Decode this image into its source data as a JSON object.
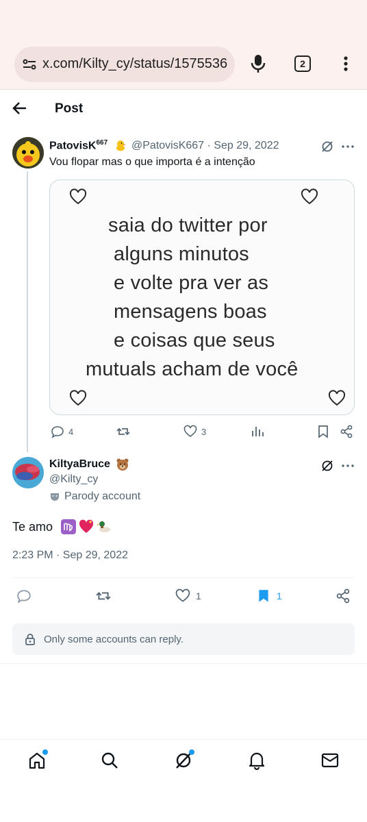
{
  "browser": {
    "url": "x.com/Kilty_cy/status/1575536",
    "tab_count": "2",
    "icons": [
      "site-settings-icon",
      "microphone-icon",
      "tabs-icon",
      "more-vert-icon"
    ]
  },
  "header": {
    "title": "Post"
  },
  "quoted_tweet": {
    "display_name": "PatovisK",
    "display_name_sup": "667",
    "handle_meta": "@PatovisK667 · Sep 29, 2022",
    "text": "Vou flopar mas o que importa é a intenção",
    "media_lines": [
      "saia do twitter por",
      "alguns minutos",
      "e volte pra ver as",
      "mensagens boas",
      "e coisas que seus",
      "mutuals acham de você"
    ],
    "actions": {
      "replies": "4",
      "retweets": "",
      "likes": "3",
      "views": ""
    }
  },
  "main_tweet": {
    "display_name": "KiltyaBruce",
    "handle": "@Kilty_cy",
    "parody_label": "Parody account",
    "text": "Te amo",
    "timestamp": "2:23 PM · Sep 29, 2022",
    "actions": {
      "replies": "",
      "retweets": "",
      "likes": "1",
      "bookmarks": "1"
    }
  },
  "reply_notice": "Only some accounts can reply.",
  "colors": {
    "accent": "#1d9bf0",
    "secondary_text": "#536471",
    "chrome_bg": "#fdf1ef"
  }
}
